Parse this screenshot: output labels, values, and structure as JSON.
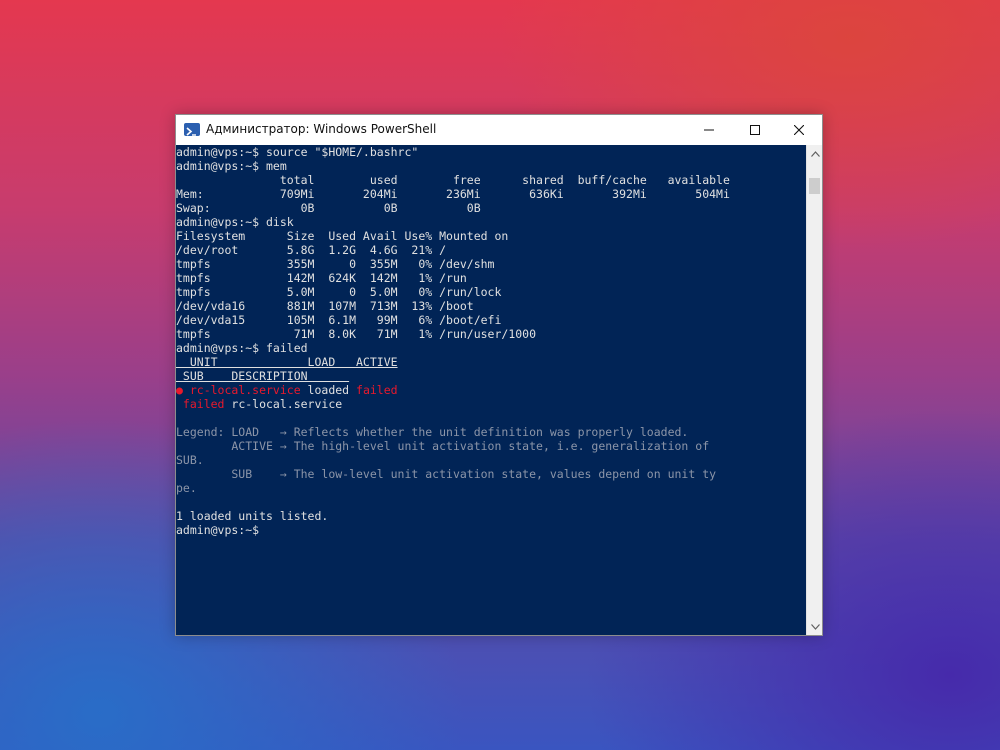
{
  "window": {
    "title": "Администратор: Windows PowerShell",
    "icon": "powershell-icon",
    "controls": [
      "minimize-icon",
      "maximize-icon",
      "close-icon"
    ]
  },
  "colors": {
    "console_bg": "#012456",
    "text": "#e0e0e0",
    "failed_red": "#e8192c",
    "legend_gray": "#8c95a8"
  },
  "terminal": {
    "l1": "admin@vps:~$ source \"$HOME/.bashrc\"",
    "l2": "admin@vps:~$ mem",
    "l3": "               total        used        free      shared  buff/cache   available",
    "l4": "Mem:           709Mi       204Mi       236Mi       636Ki       392Mi       504Mi",
    "l5": "Swap:             0B          0B          0B",
    "l6": "admin@vps:~$ disk",
    "l7": "Filesystem      Size  Used Avail Use% Mounted on",
    "l8": "/dev/root       5.8G  1.2G  4.6G  21% /",
    "l9": "tmpfs           355M     0  355M   0% /dev/shm",
    "l10": "tmpfs           142M  624K  142M   1% /run",
    "l11": "tmpfs           5.0M     0  5.0M   0% /run/lock",
    "l12": "/dev/vda16      881M  107M  713M  13% /boot",
    "l13": "/dev/vda15      105M  6.1M   99M   6% /boot/efi",
    "l14": "tmpfs            71M  8.0K   71M   1% /run/user/1000",
    "l15": "admin@vps:~$ failed",
    "l16": "  UNIT             LOAD   ACTIVE",
    "l17": " SUB    DESCRIPTION      ",
    "l18_a": "● rc-local.service",
    "l18_b": " loaded ",
    "l18_c": "failed",
    "l19_a": " failed",
    "l19_b": " rc-local.service",
    "l21": "Legend: LOAD   → Reflects whether the unit definition was properly loaded.",
    "l22": "        ACTIVE → The high-level unit activation state, i.e. generalization of",
    "l23": "SUB.",
    "l24": "        SUB    → The low-level unit activation state, values depend on unit ty",
    "l25": "pe.",
    "l27": "1 loaded units listed.",
    "l28": "admin@vps:~$"
  }
}
